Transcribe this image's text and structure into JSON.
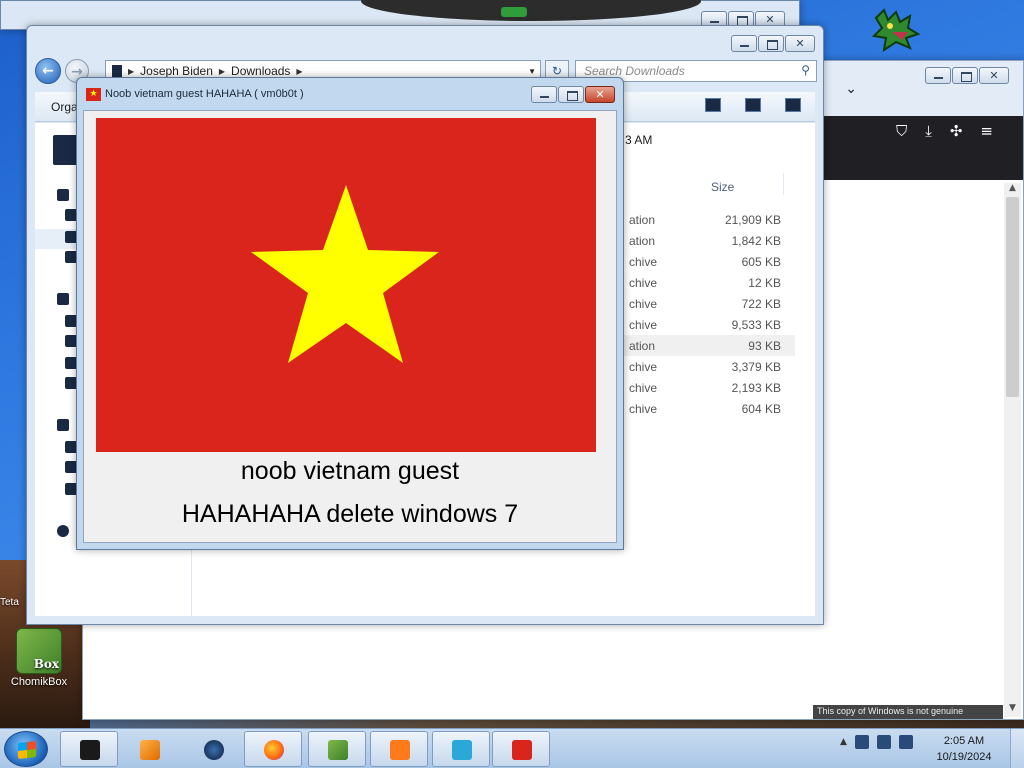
{
  "explorer": {
    "breadcrumb": [
      "Joseph Biden",
      "Downloads"
    ],
    "search_placeholder": "Search Downloads",
    "organize_label": "Orga",
    "details_time": "3 AM",
    "size_header": "Size",
    "rows": [
      {
        "type": "ation",
        "size": "21,909 KB"
      },
      {
        "type": "ation",
        "size": "1,842 KB"
      },
      {
        "type": "chive",
        "size": "605 KB"
      },
      {
        "type": "chive",
        "size": "12 KB"
      },
      {
        "type": "chive",
        "size": "722 KB"
      },
      {
        "type": "chive",
        "size": "9,533 KB"
      },
      {
        "type": "ation",
        "size": "93 KB"
      },
      {
        "type": "chive",
        "size": "3,379 KB"
      },
      {
        "type": "chive",
        "size": "2,193 KB"
      },
      {
        "type": "chive",
        "size": "604 KB"
      }
    ]
  },
  "prank": {
    "title": "Noob vietnam guest HAHAHA ( vm0b0t )",
    "line1": "noob vietnam guest",
    "line2": "HAHAHAHA delete windows 7",
    "flag_red": "#da251d",
    "star_yellow": "#ffff00"
  },
  "desktop": {
    "icon_label": "ChomikBox",
    "icon_badge": "Box",
    "peek_label": "Teta"
  },
  "browser": {
    "status_text": "This copy of Windows is not genuine"
  },
  "taskbar": {
    "time": "2:05 AM",
    "date": "10/19/2024"
  }
}
